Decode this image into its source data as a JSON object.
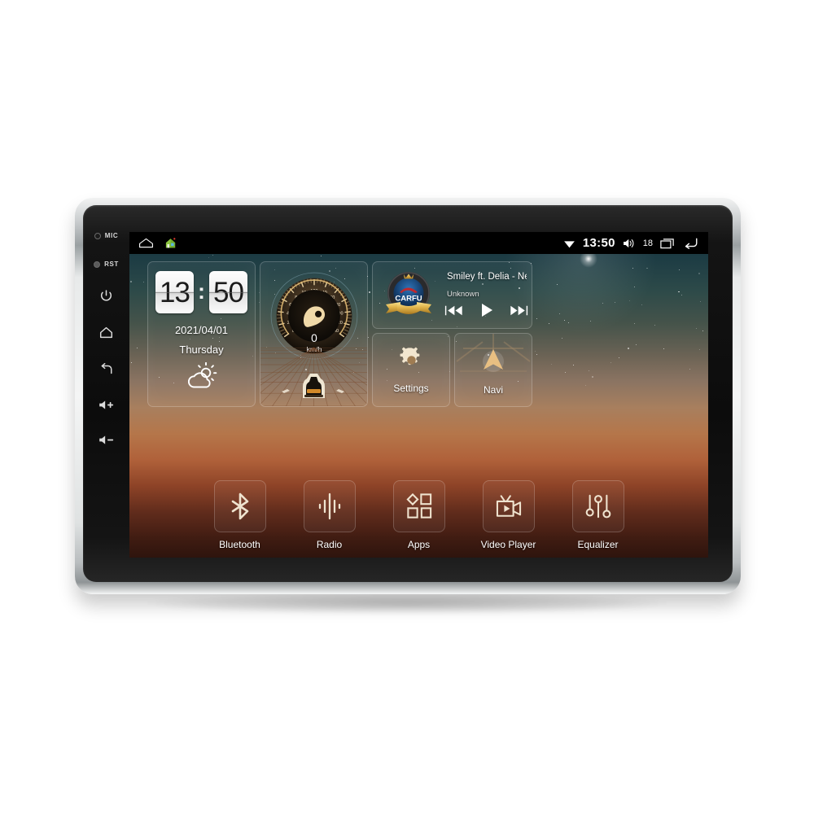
{
  "device": {
    "bezel_buttons": [
      {
        "name": "mic",
        "label": "MIC"
      },
      {
        "name": "rst",
        "label": "RST"
      },
      {
        "name": "power",
        "label": "Power"
      },
      {
        "name": "home",
        "label": "Home"
      },
      {
        "name": "back",
        "label": "Back"
      },
      {
        "name": "volume-up",
        "label": "Vol +"
      },
      {
        "name": "volume-down",
        "label": "Vol -"
      }
    ]
  },
  "statusbar": {
    "left_icons": [
      "home-outline-icon",
      "house-app-icon"
    ],
    "wifi_icon": "wifi-icon",
    "time": "13:50",
    "volume_icon": "volume-icon",
    "volume_level": "18",
    "recents_icon": "recents-icon",
    "back_icon": "back-arrow-icon"
  },
  "clock_widget": {
    "hours": "13",
    "minutes": "50",
    "separator": ":",
    "date": "2021/04/01",
    "weekday": "Thursday",
    "weather_icon": "partly-cloudy-icon"
  },
  "speedometer_widget": {
    "value": "0",
    "unit": "km/h",
    "ticks": [
      "0",
      "20",
      "40",
      "60",
      "80",
      "100",
      "120",
      "140",
      "160",
      "180",
      "200",
      "220",
      "240"
    ],
    "min": 0,
    "max": 240
  },
  "music_widget": {
    "logo_text": "CARFU",
    "title": "Smiley ft. Delia - Ne v…",
    "artist": "Unknown",
    "controls": [
      {
        "name": "previous-track-button",
        "icon": "skip-previous-icon"
      },
      {
        "name": "play-button",
        "icon": "play-icon"
      },
      {
        "name": "next-track-button",
        "icon": "skip-next-icon"
      }
    ]
  },
  "tiles": [
    {
      "name": "settings",
      "label": "Settings",
      "icon": "gear-icon"
    },
    {
      "name": "navi",
      "label": "Navi",
      "icon": "navigation-arrow-icon"
    }
  ],
  "dock": [
    {
      "name": "bluetooth",
      "label": "Bluetooth",
      "icon": "bluetooth-icon"
    },
    {
      "name": "radio",
      "label": "Radio",
      "icon": "radio-waves-icon"
    },
    {
      "name": "apps",
      "label": "Apps",
      "icon": "apps-grid-icon"
    },
    {
      "name": "video-player",
      "label": "Video Player",
      "icon": "video-camera-icon"
    },
    {
      "name": "equalizer",
      "label": "Equalizer",
      "icon": "equalizer-sliders-icon"
    }
  ],
  "colors": {
    "accent_gold": "#e0b872",
    "sky_top": "#17313c",
    "ground_bottom": "#2e140d",
    "status_bar": "#000000",
    "logo_blue": "#1b4f86",
    "logo_red": "#c0282d"
  }
}
